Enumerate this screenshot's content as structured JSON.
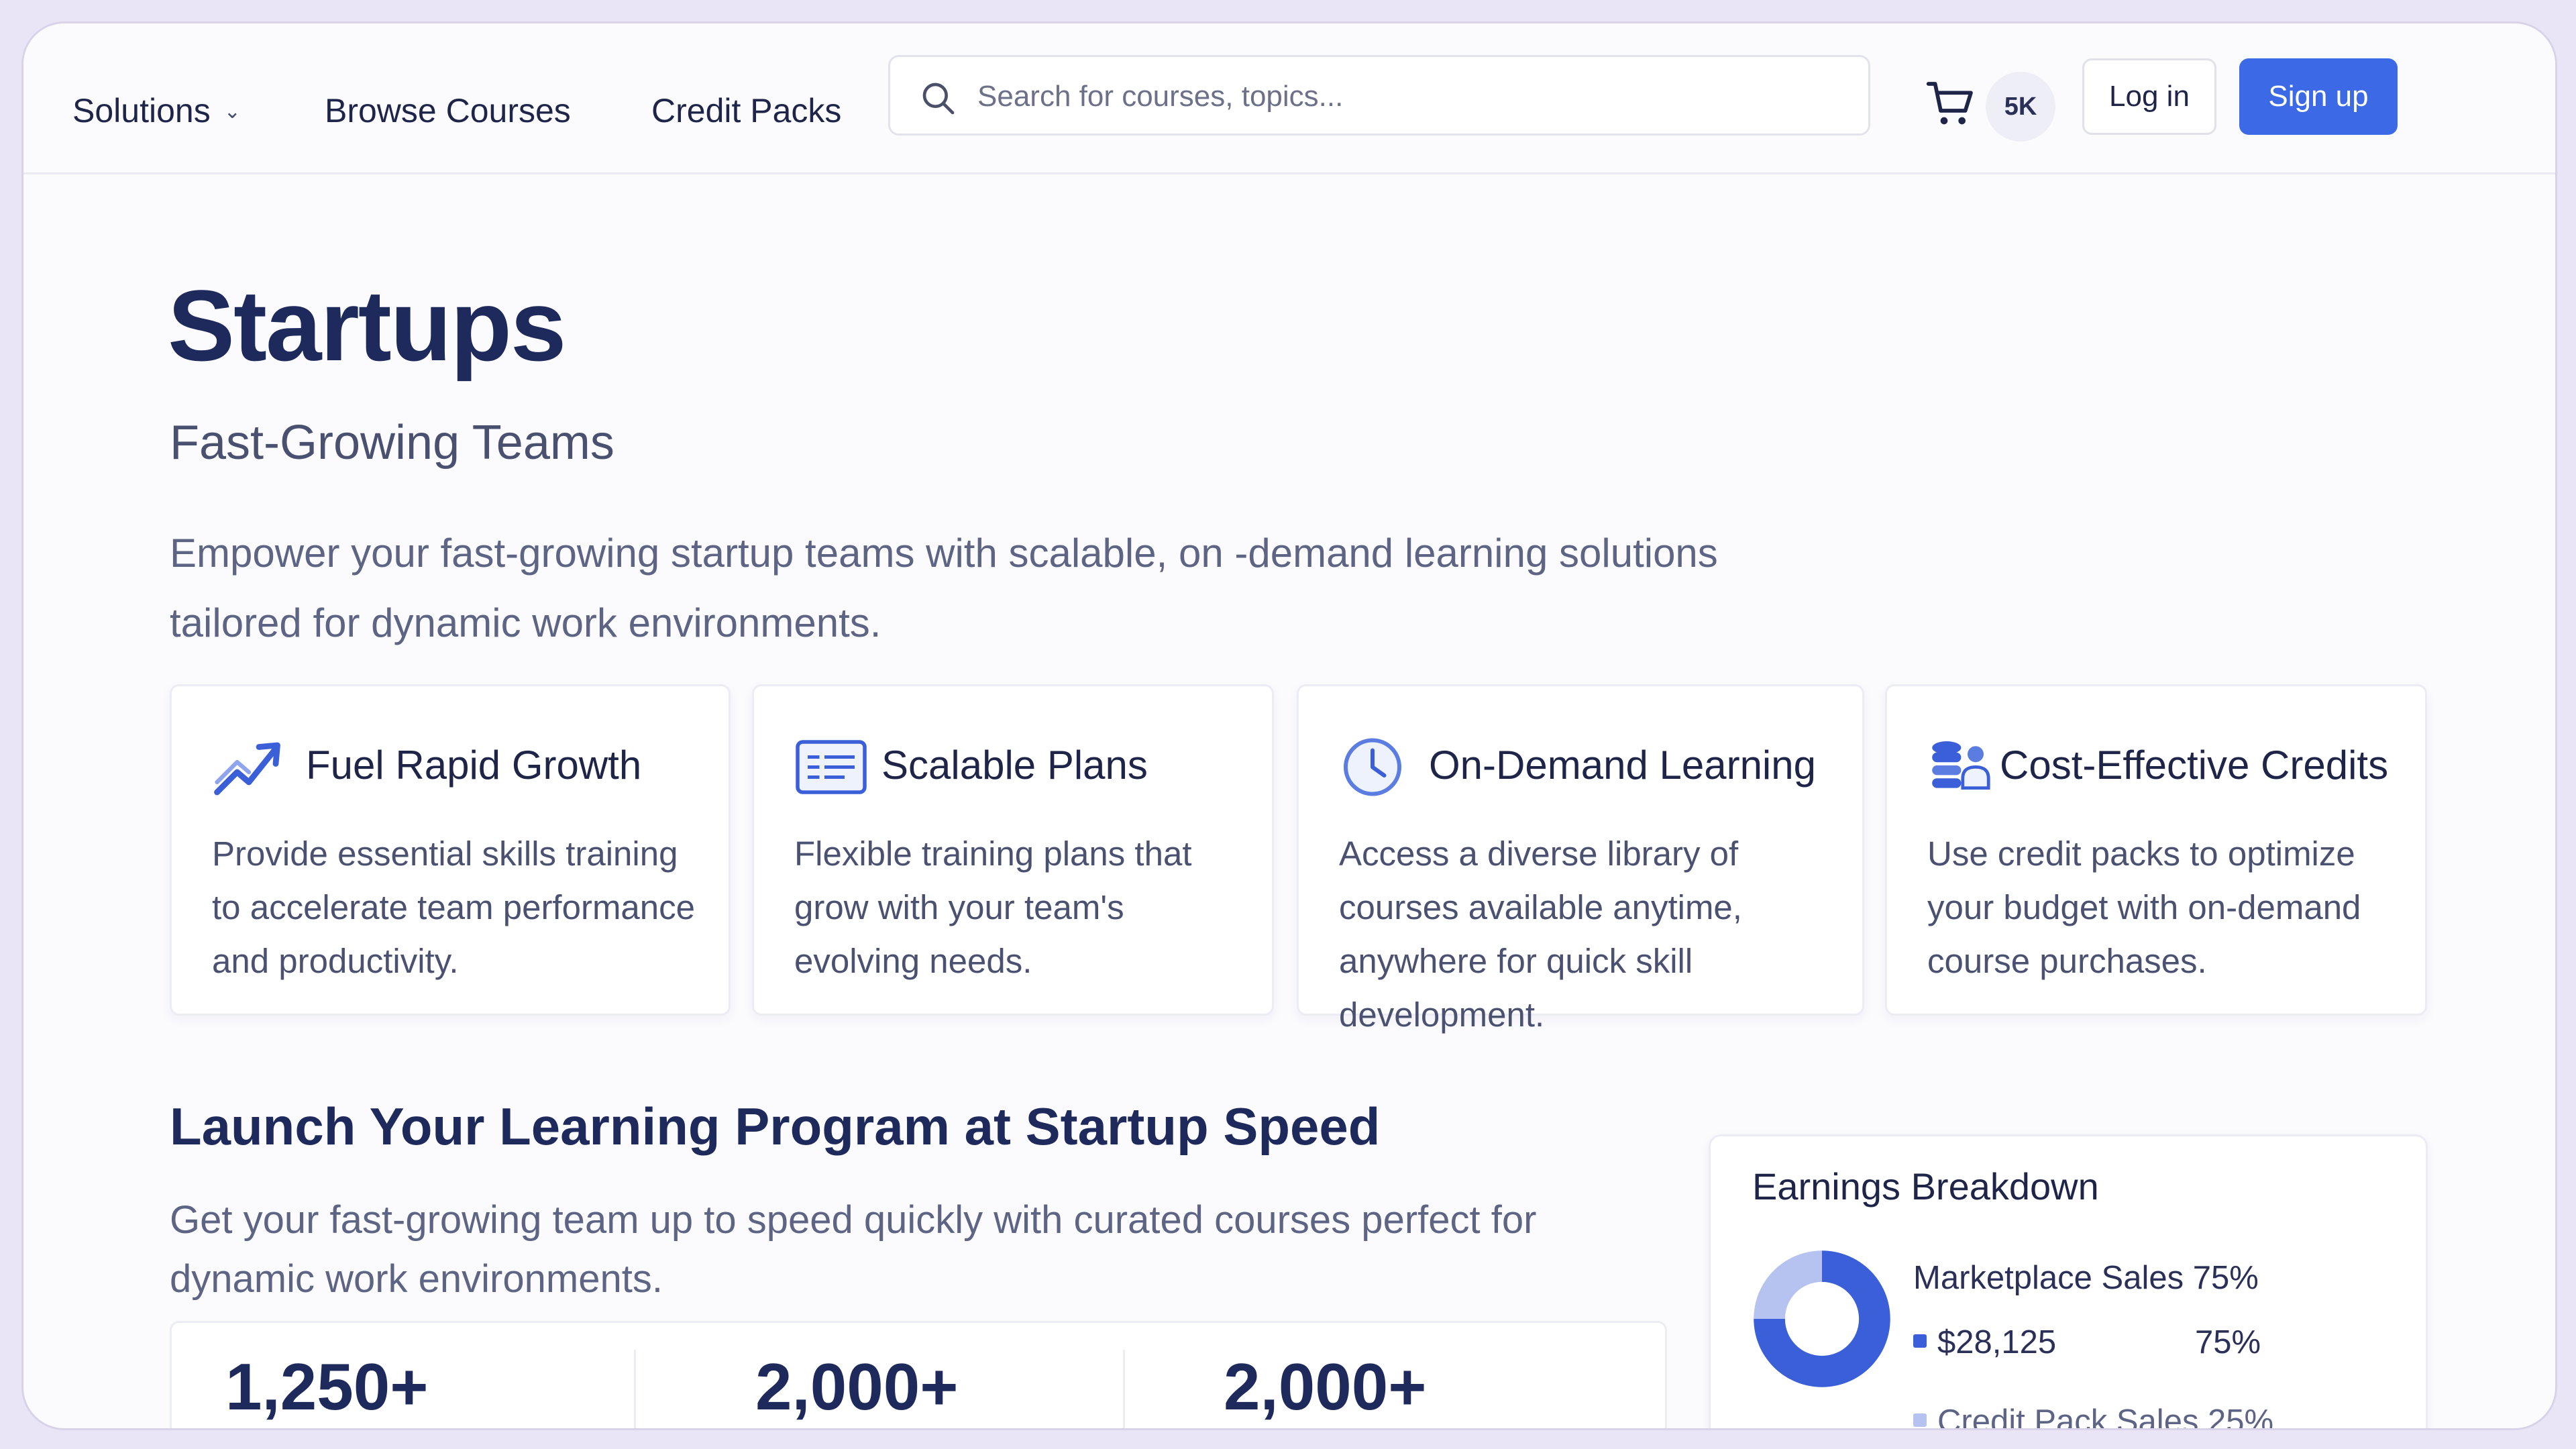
{
  "nav": {
    "solutions_label": "Solutions",
    "browse_label": "Browse Courses",
    "credit_label": "Credit Packs",
    "search_placeholder": "Search for courses, topics...",
    "cart_badge": "5K",
    "login_label": "Log in",
    "signup_label": "Sign up"
  },
  "hero": {
    "title": "Startups",
    "subtitle": "Fast-Growing Teams",
    "description": "Empower your fast-growing startup teams with scalable, on -demand learning solutions tailored for dynamic work environments."
  },
  "features": [
    {
      "icon": "trend-up-icon",
      "title": "Fuel Rapid Growth",
      "text": "Provide essential skills training to accelerate team performance and productivity."
    },
    {
      "icon": "list-card-icon",
      "title": "Scalable Plans",
      "text": "Flexible training plans that grow with your team's evolving needs."
    },
    {
      "icon": "clock-icon",
      "title": "On-Demand Learning",
      "text": "Access a diverse library of courses available anytime, anywhere for quick skill development."
    },
    {
      "icon": "coins-user-icon",
      "title": "Cost-Effective Credits",
      "text": "Use credit packs to optimize your budget with on-demand course purchases."
    }
  ],
  "launch": {
    "title": "Launch Your Learning Program at Startup Speed",
    "description": "Get your fast-growing team up to speed quickly with curated courses perfect for dynamic work environments.",
    "stats": [
      "1,250+",
      "2,000+",
      "2,000+"
    ]
  },
  "earnings": {
    "title": "Earnings Breakdown",
    "marketplace_label": "Marketplace Sales 75%",
    "marketplace_amount": "$28,125",
    "marketplace_pct": "75%",
    "credit_label": "Credit Pack Sales 25%",
    "colors": {
      "marketplace": "#3b5fd8",
      "credit": "#b6c2f0"
    }
  },
  "chart_data": {
    "type": "pie",
    "title": "Earnings Breakdown",
    "categories": [
      "Marketplace Sales",
      "Credit Pack Sales"
    ],
    "values": [
      75,
      25
    ]
  },
  "colors": {
    "accent": "#3c69e6",
    "heading": "#1f2a5c"
  }
}
